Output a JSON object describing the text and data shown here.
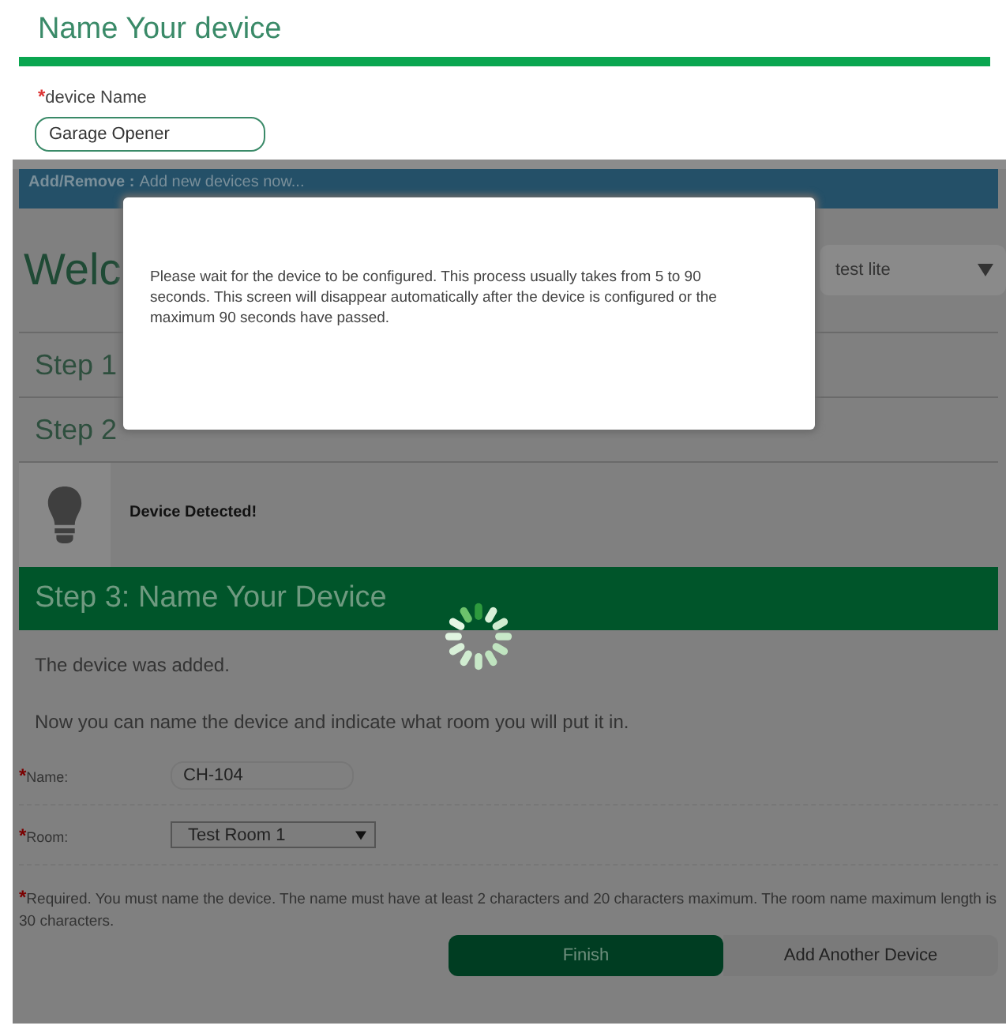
{
  "page": {
    "title": "Name Your device"
  },
  "device_name": {
    "required_mark": "*",
    "label": "device Name",
    "value": "Garage Opener"
  },
  "background_screen": {
    "banner": {
      "label": "Add/Remove :",
      "text": "Add new devices now..."
    },
    "heading": "Welc",
    "hub_select": {
      "value": "test lite"
    },
    "steps": [
      {
        "title": "Step 1"
      },
      {
        "title": "Step 2"
      }
    ],
    "detected": {
      "text": "Device Detected!"
    },
    "step3": {
      "title": "Step 3: Name Your Device",
      "added": "The device was added.",
      "instructions": "Now you can name the device and indicate what room you will put it in.",
      "fields": [
        {
          "kind": "text",
          "required_mark": "*",
          "label": "Name:",
          "value": "CH-104"
        },
        {
          "kind": "select",
          "required_mark": "*",
          "label": "Room:",
          "value": "Test Room 1"
        }
      ],
      "note_mark": "*",
      "note": "Required. You must name the device. The name must have at least 2 characters and 20 characters maximum. The room name maximum length is 30 characters.",
      "buttons": [
        {
          "label": "Finish",
          "primary": true
        },
        {
          "label": "Add Another Device",
          "primary": false
        }
      ]
    }
  },
  "modal": {
    "message": "Please wait for the device to be configured. This process usually takes from 5 to 90 seconds. This screen will disappear automatically after the device is configured or the maximum 90 seconds have passed."
  }
}
